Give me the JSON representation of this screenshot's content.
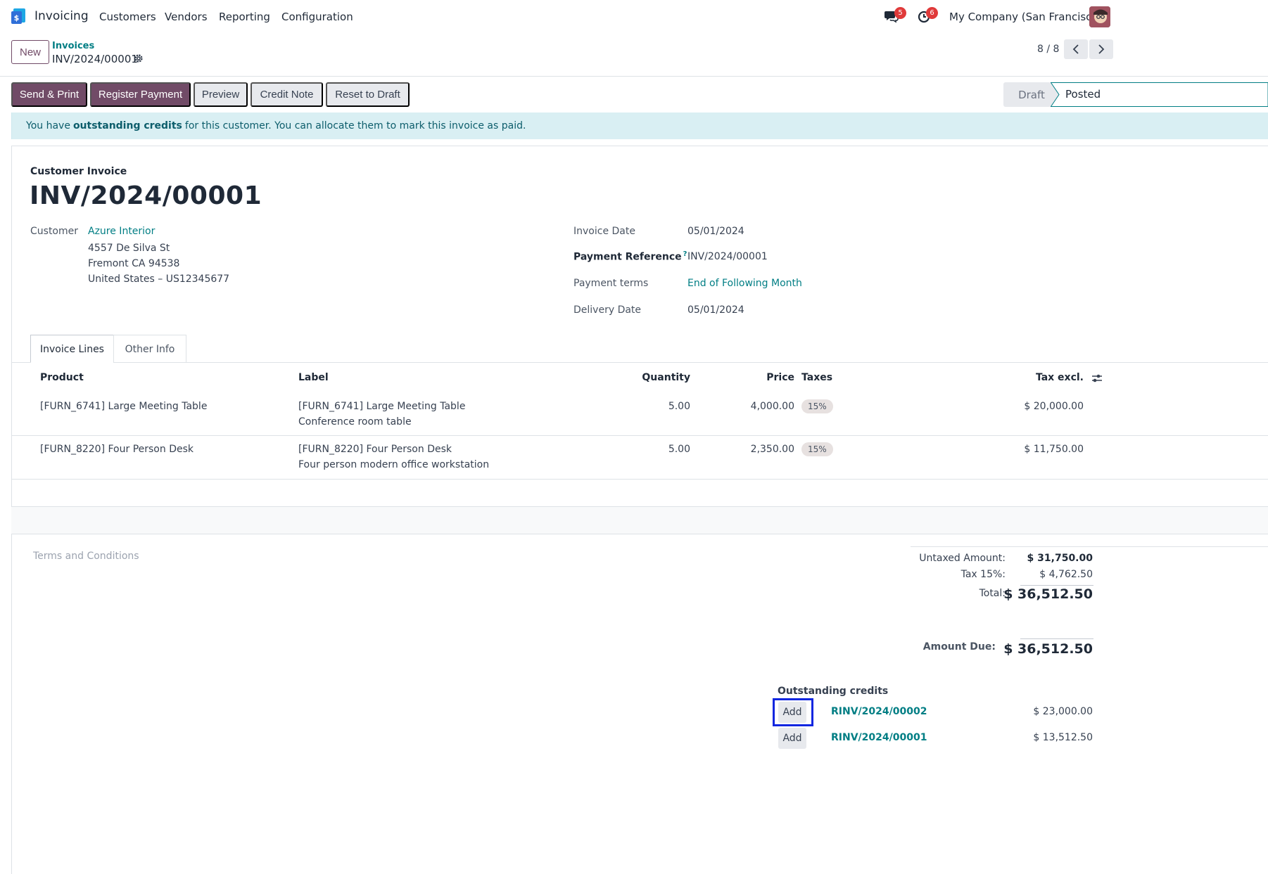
{
  "navbar": {
    "app_name": "Invoicing",
    "menus": [
      "Customers",
      "Vendors",
      "Reporting",
      "Configuration"
    ],
    "messages_count": "5",
    "activities_count": "6",
    "company": "My Company (San Francisco)"
  },
  "control_panel": {
    "new_label": "New",
    "breadcrumb_parent": "Invoices",
    "breadcrumb_current": "INV/2024/00001",
    "pager": "8 / 8"
  },
  "actions": {
    "send_print": "Send & Print",
    "register_payment": "Register Payment",
    "preview": "Preview",
    "credit_note": "Credit Note",
    "reset_to_draft": "Reset to Draft"
  },
  "status": {
    "stages": [
      "Draft",
      "Posted"
    ],
    "current": "Posted"
  },
  "alert": {
    "prefix": "You have",
    "bold": "outstanding credits",
    "suffix": "for this customer. You can allocate them to mark this invoice as paid."
  },
  "invoice": {
    "type": "Customer Invoice",
    "name": "INV/2024/00001",
    "customer_label": "Customer",
    "customer_name": "Azure Interior",
    "address_lines": [
      "4557 De Silva St",
      "Fremont CA 94538",
      "United States – US12345677"
    ],
    "invoice_date_label": "Invoice Date",
    "invoice_date": "05/01/2024",
    "payment_reference_label": "Payment Reference",
    "payment_reference_help": "?",
    "payment_reference": "INV/2024/00001",
    "payment_terms_label": "Payment terms",
    "payment_terms": "End of Following Month",
    "delivery_date_label": "Delivery Date",
    "delivery_date": "05/01/2024"
  },
  "tabs": [
    "Invoice Lines",
    "Other Info"
  ],
  "lines": {
    "headers": [
      "Product",
      "Label",
      "Quantity",
      "Price",
      "Taxes",
      "Tax excl."
    ],
    "rows": [
      {
        "product": "[FURN_6741] Large Meeting Table",
        "label_line1": "[FURN_6741] Large Meeting Table",
        "label_line2": "Conference room table",
        "quantity": "5.00",
        "price": "4,000.00",
        "tax": "15%",
        "subtotal": "$ 20,000.00"
      },
      {
        "product": "[FURN_8220] Four Person Desk",
        "label_line1": "[FURN_8220] Four Person Desk",
        "label_line2": "Four person modern office workstation",
        "quantity": "5.00",
        "price": "2,350.00",
        "tax": "15%",
        "subtotal": "$ 11,750.00"
      }
    ]
  },
  "terms_placeholder": "Terms and Conditions",
  "totals": {
    "untaxed_label": "Untaxed Amount:",
    "untaxed_value": "$ 31,750.00",
    "tax_label": "Tax 15%:",
    "tax_value": "$ 4,762.50",
    "total_label": "Total:",
    "total_value": "$ 36,512.50",
    "amount_due_label": "Amount Due:",
    "amount_due_value": "$ 36,512.50"
  },
  "outstanding_credits": {
    "title": "Outstanding credits",
    "add_label": "Add",
    "items": [
      {
        "ref": "RINV/2024/00002",
        "amount": "$ 23,000.00"
      },
      {
        "ref": "RINV/2024/00001",
        "amount": "$ 13,512.50"
      }
    ]
  },
  "colors": {
    "primary": "#714b67",
    "link": "#017e84",
    "alert_bg": "#d9eff3",
    "highlight_box": "#1026e0"
  }
}
